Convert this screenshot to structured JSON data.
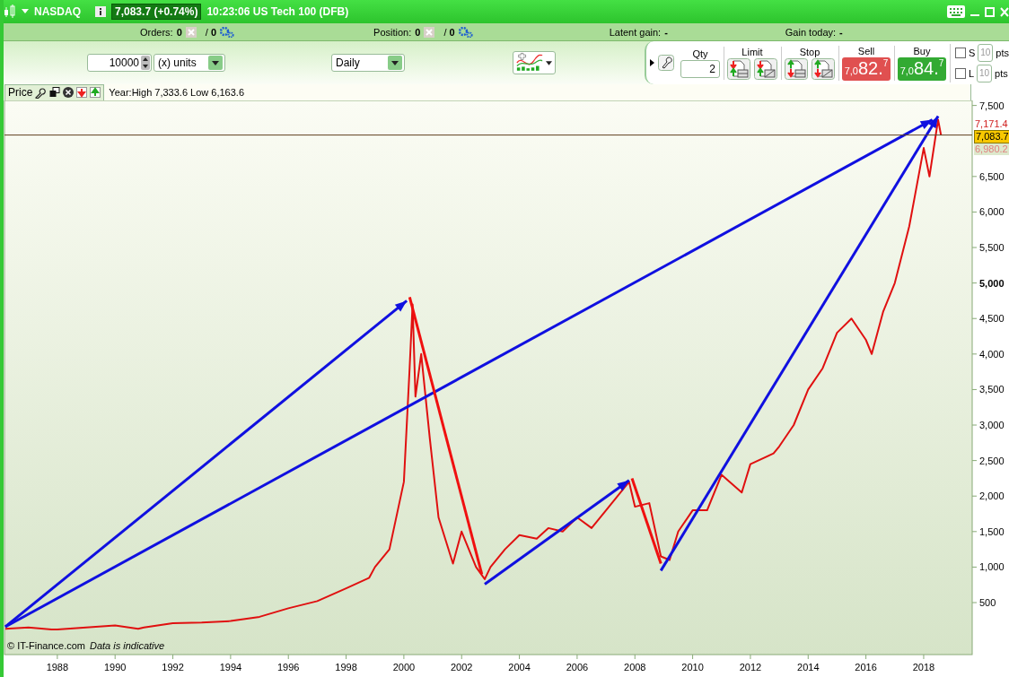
{
  "title_bar": {
    "instrument": "NASDAQ",
    "quote": "7,083.7 (+0.74%)",
    "time_name": "10:23:06 US Tech 100 (DFB)"
  },
  "info_bar": [
    {
      "kind": "count",
      "label": "Orders:",
      "value": "0",
      "total": "/ **0**"
    },
    {
      "kind": "count",
      "label": "Position:",
      "value": "0",
      "total": "/ **0**"
    },
    {
      "kind": "gain",
      "label": "Latent gain:",
      "value": "-"
    },
    {
      "kind": "gain",
      "label": "Gain today:",
      "value": "-"
    }
  ],
  "toolbar": {
    "quantity": "10000",
    "unit": "(x) units",
    "period": "Daily"
  },
  "trade_panel": {
    "qty_label": "Qty",
    "qty": "2",
    "limit_label": "Limit",
    "stop_label": "Stop",
    "sell": {
      "label": "Sell",
      "prefix": "7,0",
      "big": "82.",
      "pip": "7"
    },
    "buy": {
      "label": "Buy",
      "prefix": "7,0",
      "big": "84.",
      "pip": "7"
    },
    "options": [
      {
        "letter": "S",
        "placeholder": "10",
        "unit": "pts",
        "checked": false
      },
      {
        "letter": "L",
        "placeholder": "10",
        "unit": "pts",
        "checked": false
      }
    ]
  },
  "chart": {
    "range_text": "Year:High 7,333.6 Low 6,163.6",
    "copyright": "© IT-Finance.com",
    "disclaimer": "Data is indicative",
    "price_tags": [
      {
        "text": "7,171.4",
        "kind": "high"
      },
      {
        "text": "7,083.7",
        "kind": "last"
      },
      {
        "text": "6,980.2",
        "kind": "low"
      }
    ],
    "chart_data": {
      "type": "line",
      "xlim": [
        1986.17,
        2019.68
      ],
      "ylim": [
        -232,
        7571
      ],
      "x": [
        1986.2,
        1987,
        1987.8,
        1988,
        1989,
        1990,
        1990.8,
        1991,
        1992,
        1993,
        1994,
        1995,
        1996,
        1997,
        1998,
        1998.8,
        1999,
        1999.5,
        2000,
        2000.2,
        2000.3,
        2000.4,
        2000.6,
        2000.9,
        2001.2,
        2001.7,
        2002,
        2002.5,
        2002.8,
        2003,
        2003.5,
        2004,
        2004.6,
        2005,
        2005.5,
        2006,
        2006.5,
        2007,
        2007.8,
        2008,
        2008.5,
        2008.9,
        2009.2,
        2009.5,
        2010,
        2010.5,
        2011,
        2011.7,
        2012,
        2012.8,
        2013,
        2013.5,
        2014,
        2014.5,
        2015,
        2015.5,
        2016,
        2016.2,
        2016.6,
        2017,
        2017.5,
        2018,
        2018.2,
        2018.5,
        2018.6
      ],
      "series": [
        {
          "name": "Price",
          "color": "#e01010",
          "values": [
            130,
            150,
            120,
            120,
            150,
            180,
            130,
            150,
            210,
            220,
            240,
            300,
            420,
            520,
            700,
            850,
            1000,
            1250,
            2200,
            3800,
            4700,
            3400,
            4000,
            2800,
            1700,
            1050,
            1500,
            1000,
            830,
            1000,
            1250,
            1450,
            1400,
            1550,
            1500,
            1700,
            1550,
            1800,
            2200,
            1850,
            1900,
            1150,
            1100,
            1500,
            1800,
            1800,
            2300,
            2050,
            2450,
            2600,
            2700,
            3000,
            3500,
            3800,
            4300,
            4500,
            4200,
            4000,
            4600,
            5000,
            5800,
            6900,
            6500,
            7300,
            7080
          ]
        }
      ],
      "xticks": [
        1988,
        1990,
        1992,
        1994,
        1996,
        1998,
        2000,
        2002,
        2004,
        2006,
        2008,
        2010,
        2012,
        2014,
        2016,
        2018
      ],
      "yticks": [
        {
          "value": 500,
          "label": "500"
        },
        {
          "value": 1000,
          "label": "1,000"
        },
        {
          "value": 1500,
          "label": "1,500"
        },
        {
          "value": 2000,
          "label": "2,000"
        },
        {
          "value": 2500,
          "label": "2,500"
        },
        {
          "value": 3000,
          "label": "3,000"
        },
        {
          "value": 3500,
          "label": "3,500"
        },
        {
          "value": 4000,
          "label": "4,000"
        },
        {
          "value": 4500,
          "label": "4,500"
        },
        {
          "value": 5000,
          "label": "5,000"
        },
        {
          "value": 5500,
          "label": "5,500"
        },
        {
          "value": 6000,
          "label": "6,000"
        },
        {
          "value": 6500,
          "label": "6,500"
        },
        {
          "value": 7500,
          "label": "7,500"
        }
      ]
    },
    "trend_marks": [
      {
        "kind": "arrow",
        "color": "#1010e0"
      },
      {
        "kind": "arrow",
        "color": "#1010e0"
      },
      {
        "kind": "arrow",
        "color": "#1010e0"
      },
      {
        "kind": "arrow",
        "color": "#1010e0"
      },
      {
        "kind": "line",
        "color": "#f01010"
      },
      {
        "kind": "line",
        "color": "#f01010"
      },
      {
        "kind": "level"
      }
    ]
  }
}
